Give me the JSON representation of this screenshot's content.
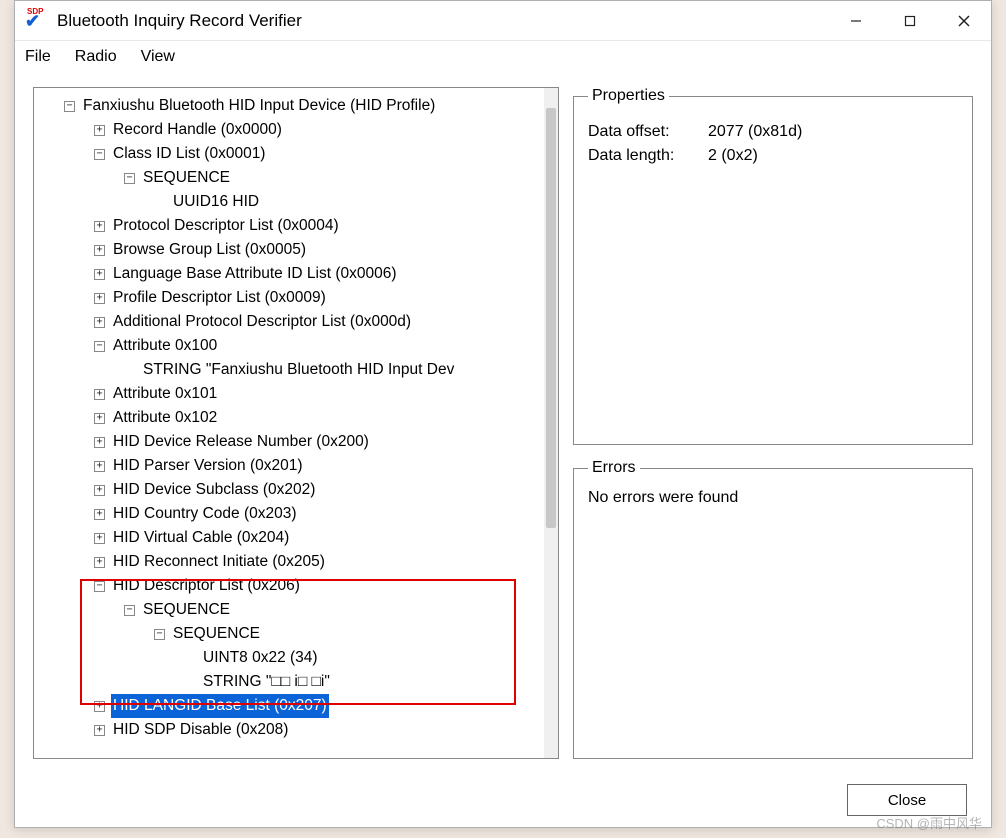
{
  "window": {
    "title": "Bluetooth Inquiry Record Verifier"
  },
  "menu": {
    "file": "File",
    "radio": "Radio",
    "view": "View"
  },
  "properties": {
    "legend": "Properties",
    "data_offset_label": "Data offset:",
    "data_offset_value": "2077 (0x81d)",
    "data_length_label": "Data length:",
    "data_length_value": "2 (0x2)"
  },
  "errors": {
    "legend": "Errors",
    "text": "No errors were found"
  },
  "footer": {
    "close": "Close"
  },
  "tree": {
    "root": "Fanxiushu Bluetooth HID Input Device (HID Profile)",
    "record_handle": "Record Handle (0x0000)",
    "class_id_list": "Class ID List (0x0001)",
    "class_seq": "SEQUENCE",
    "class_uuid": "UUID16 HID",
    "protocol_desc": "Protocol Descriptor List (0x0004)",
    "browse_group": "Browse Group List (0x0005)",
    "lang_base": "Language Base Attribute ID List (0x0006)",
    "profile_desc": "Profile Descriptor List (0x0009)",
    "add_protocol": "Additional Protocol Descriptor List (0x000d)",
    "attr100": "Attribute 0x100",
    "attr100_str": "STRING \"Fanxiushu Bluetooth HID Input Dev",
    "attr101": "Attribute 0x101",
    "attr102": "Attribute 0x102",
    "hid_release": "HID Device Release Number (0x200)",
    "hid_parser": "HID Parser Version (0x201)",
    "hid_subclass": "HID Device Subclass (0x202)",
    "hid_country": "HID Country Code (0x203)",
    "hid_vcable": "HID Virtual Cable (0x204)",
    "hid_reconnect": "HID Reconnect Initiate (0x205)",
    "hid_desc_list": "HID Descriptor List (0x206)",
    "desc_seq1": "SEQUENCE",
    "desc_seq2": "SEQUENCE",
    "desc_uint8": "UINT8 0x22 (34)",
    "desc_string": "STRING \"□□ i□ □i\"",
    "hid_langid": "HID LANGID Base List (0x207)",
    "hid_sdp_disable": "HID SDP Disable (0x208)"
  },
  "watermark": "CSDN @雨中风华"
}
